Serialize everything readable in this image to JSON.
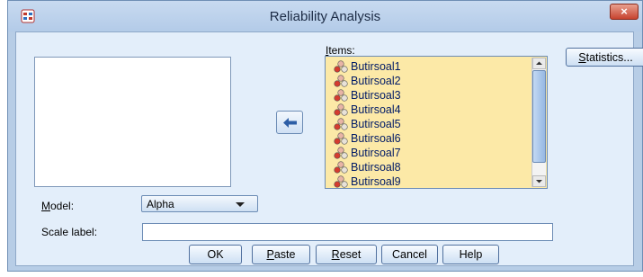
{
  "window": {
    "title": "Reliability Analysis",
    "close_glyph": "×"
  },
  "items_header": {
    "prefix": "I",
    "rest": "tems:"
  },
  "items": [
    "Butirsoal1",
    "Butirsoal2",
    "Butirsoal3",
    "Butirsoal4",
    "Butirsoal5",
    "Butirsoal6",
    "Butirsoal7",
    "Butirsoal8",
    "Butirsoal9"
  ],
  "statistics_button": {
    "prefix": "S",
    "rest": "tatistics..."
  },
  "model": {
    "label_prefix": "M",
    "label_rest": "odel:",
    "value": "Alpha"
  },
  "scale_label": {
    "label": "Scale label:",
    "value": ""
  },
  "buttons": {
    "ok": "OK",
    "paste_prefix": "P",
    "paste_rest": "aste",
    "reset_prefix": "R",
    "reset_rest": "eset",
    "cancel": "Cancel",
    "help": "Help"
  },
  "icons": {
    "variable_icon": "scale-variable-icon",
    "move_icon": "arrow-left-icon"
  }
}
